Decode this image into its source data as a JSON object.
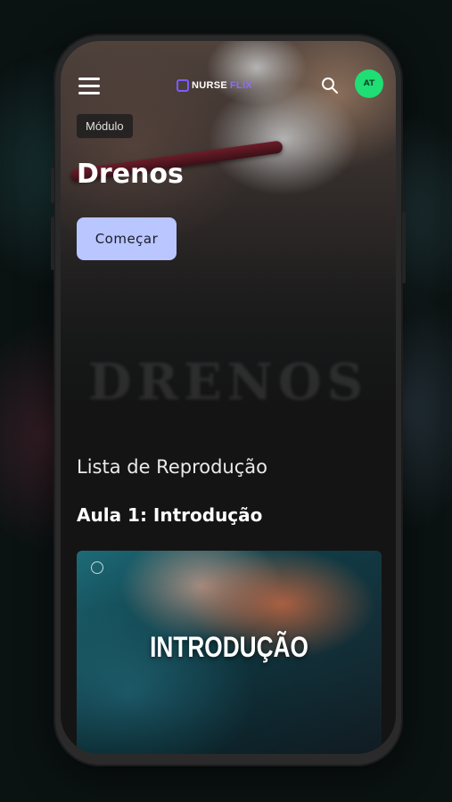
{
  "app": {
    "logo_part1": "NURSE",
    "logo_part2": "FLIX"
  },
  "header": {
    "avatar_initials": "AT"
  },
  "hero": {
    "badge": "Módulo",
    "title": "Drenos",
    "start_label": "Começar",
    "watermark": "DRENOS"
  },
  "playlist": {
    "heading": "Lista de Reprodução",
    "lesson_title": "Aula 1: Introdução",
    "thumbnail_text": "INTRODUÇÃO"
  },
  "colors": {
    "accent_button": "#b9c6ff",
    "avatar": "#1fde74",
    "logo_accent": "#8a6cff"
  },
  "icons": [
    "menu-icon",
    "search-icon",
    "info-icon"
  ]
}
